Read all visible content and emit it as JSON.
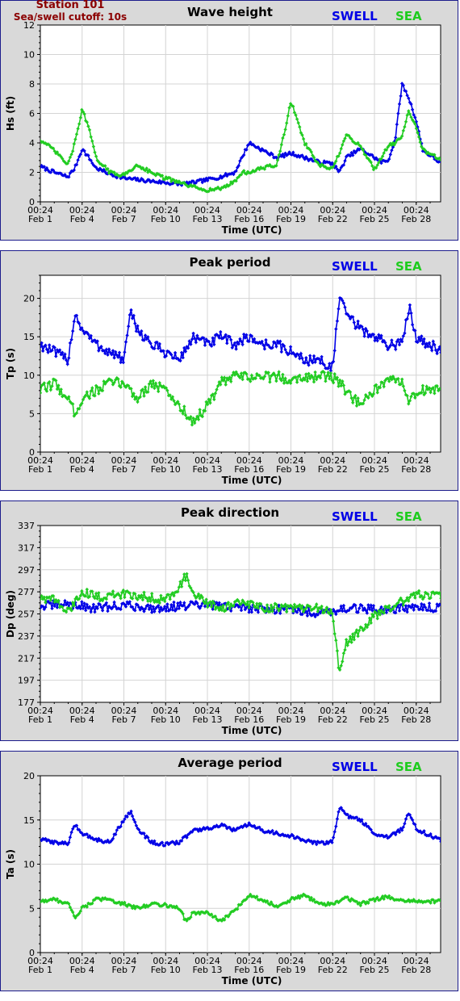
{
  "station": {
    "line1": "Station 101",
    "line2": "Sea/swell cutoff: 10s"
  },
  "legend": {
    "swell": "SWELL",
    "sea": "SEA"
  },
  "colors": {
    "swell": "#0000e6",
    "sea": "#22cc22",
    "panel": "#d9d9d9",
    "border": "#1c1c8c",
    "grid": "#d4d4d4"
  },
  "x_tick_labels": [
    [
      "00:24",
      "Feb 1"
    ],
    [
      "00:24",
      "Feb 4"
    ],
    [
      "00:24",
      "Feb 7"
    ],
    [
      "00:24",
      "Feb 10"
    ],
    [
      "00:24",
      "Feb 13"
    ],
    [
      "00:24",
      "Feb 16"
    ],
    [
      "00:24",
      "Feb 19"
    ],
    [
      "00:24",
      "Feb 22"
    ],
    [
      "00:24",
      "Feb 25"
    ],
    [
      "00:24",
      "Feb 28"
    ]
  ],
  "chart_data": [
    {
      "type": "scatter",
      "title": "Wave height",
      "ylabel": "Hs (ft)",
      "xlabel": "Time (UTC)",
      "ylim": [
        0,
        12
      ],
      "yticks": [
        "0",
        "2",
        "4",
        "6",
        "8",
        "10",
        "12"
      ],
      "xlim": [
        "Feb 1 00:24",
        "Mar 2 18:00"
      ],
      "grid": true,
      "legend_position": "top-right",
      "series": [
        {
          "name": "SWELL",
          "x": [
            "Feb 1 00:24",
            "Feb 2 00:00",
            "Feb 3 00:00",
            "Feb 3 12:00",
            "Feb 4 00:24",
            "Feb 4 12:00",
            "Feb 5 00:00",
            "Feb 6 00:00",
            "Feb 7 00:24",
            "Feb 8 00:00",
            "Feb 9 00:00",
            "Feb 10 00:24",
            "Feb 11 00:00",
            "Feb 12 00:00",
            "Feb 13 00:24",
            "Feb 14 00:00",
            "Feb 15 00:00",
            "Feb 15 12:00",
            "Feb 16 00:24",
            "Feb 17 00:00",
            "Feb 18 00:00",
            "Feb 19 00:24",
            "Feb 20 00:00",
            "Feb 21 00:00",
            "Feb 22 00:24",
            "Feb 22 12:00",
            "Feb 23 00:00",
            "Feb 24 00:00",
            "Feb 25 00:24",
            "Feb 25 12:00",
            "Feb 26 00:00",
            "Feb 26 12:00",
            "Feb 27 00:00",
            "Feb 27 12:00",
            "Feb 28 00:24",
            "Feb 28 12:00",
            "Mar 1 00:00",
            "Mar 1 12:00",
            "Mar 2 00:00",
            "Mar 2 18:00"
          ],
          "values": [
            2.4,
            2.0,
            1.7,
            2.3,
            3.6,
            3.0,
            2.3,
            1.9,
            1.6,
            1.5,
            1.4,
            1.3,
            1.2,
            1.3,
            1.5,
            1.7,
            2.0,
            3.0,
            4.0,
            3.5,
            3.0,
            3.3,
            3.0,
            2.7,
            2.6,
            2.0,
            3.0,
            3.6,
            3.0,
            2.7,
            2.8,
            4.2,
            8.0,
            7.0,
            5.5,
            3.5,
            2.5,
            2.0,
            2.1,
            2.3
          ]
        },
        {
          "name": "SEA",
          "x": [
            "Feb 1 00:24",
            "Feb 2 00:00",
            "Feb 3 00:00",
            "Feb 3 12:00",
            "Feb 4 00:24",
            "Feb 4 12:00",
            "Feb 5 00:00",
            "Feb 6 00:00",
            "Feb 7 00:24",
            "Feb 8 00:00",
            "Feb 9 00:00",
            "Feb 10 00:24",
            "Feb 11 00:00",
            "Feb 12 00:00",
            "Feb 13 00:24",
            "Feb 14 00:00",
            "Feb 15 00:00",
            "Feb 15 12:00",
            "Feb 16 00:24",
            "Feb 17 00:00",
            "Feb 18 00:00",
            "Feb 18 12:00",
            "Feb 19 00:24",
            "Feb 19 12:00",
            "Feb 20 00:00",
            "Feb 21 00:00",
            "Feb 22 00:24",
            "Feb 23 00:00",
            "Feb 24 00:00",
            "Feb 25 00:24",
            "Feb 26 00:00",
            "Feb 26 12:00",
            "Feb 27 00:00",
            "Feb 27 12:00",
            "Feb 28 00:24",
            "Feb 28 12:00",
            "Mar 1 00:00",
            "Mar 2 00:00",
            "Mar 2 18:00"
          ],
          "values": [
            4.2,
            3.5,
            2.5,
            4.0,
            6.3,
            5.0,
            3.0,
            2.0,
            1.8,
            2.5,
            2.0,
            1.6,
            1.3,
            1.0,
            0.8,
            0.9,
            1.4,
            2.0,
            2.0,
            2.3,
            2.5,
            4.5,
            6.8,
            5.5,
            4.0,
            2.5,
            2.2,
            4.5,
            3.8,
            2.2,
            3.8,
            4.0,
            4.5,
            6.2,
            5.0,
            3.5,
            2.8,
            2.5,
            2.5
          ]
        }
      ]
    },
    {
      "type": "scatter",
      "title": "Peak period",
      "ylabel": "Tp (s)",
      "xlabel": "Time (UTC)",
      "ylim": [
        0,
        23
      ],
      "yticks": [
        "0",
        "5",
        "10",
        "15",
        "20"
      ],
      "grid": true,
      "legend_position": "top-right",
      "series": [
        {
          "name": "SWELL",
          "x": [
            "Feb 1 00:24",
            "Feb 2 00:00",
            "Feb 3 00:00",
            "Feb 3 12:00",
            "Feb 4 00:24",
            "Feb 5 00:00",
            "Feb 6 00:00",
            "Feb 7 00:24",
            "Feb 7 12:00",
            "Feb 8 00:00",
            "Feb 9 00:00",
            "Feb 10 00:24",
            "Feb 11 00:00",
            "Feb 12 00:00",
            "Feb 13 00:24",
            "Feb 14 00:00",
            "Feb 15 00:00",
            "Feb 16 00:24",
            "Feb 17 00:00",
            "Feb 18 00:00",
            "Feb 19 00:24",
            "Feb 20 00:00",
            "Feb 21 00:00",
            "Feb 22 00:24",
            "Feb 22 12:00",
            "Feb 23 00:00",
            "Feb 24 00:00",
            "Feb 25 00:24",
            "Feb 26 00:00",
            "Feb 27 00:00",
            "Feb 27 12:00",
            "Feb 28 00:24",
            "Mar 1 00:00",
            "Mar 1 12:00",
            "Mar 2 00:00",
            "Mar 2 18:00"
          ],
          "values": [
            14,
            13,
            12,
            18,
            16,
            14,
            13,
            12,
            18,
            16,
            14,
            13,
            12,
            15,
            14,
            15,
            14,
            15,
            14,
            14,
            13,
            12,
            12,
            11,
            20,
            18,
            16,
            15,
            14,
            14,
            19,
            15,
            13,
            11,
            19,
            16
          ]
        },
        {
          "name": "SEA",
          "x": [
            "Feb 1 00:24",
            "Feb 2 00:00",
            "Feb 3 00:00",
            "Feb 3 12:00",
            "Feb 4 00:24",
            "Feb 5 00:00",
            "Feb 6 00:00",
            "Feb 7 00:24",
            "Feb 8 00:00",
            "Feb 9 00:00",
            "Feb 10 00:24",
            "Feb 11 00:00",
            "Feb 12 00:00",
            "Feb 13 00:24",
            "Feb 14 00:00",
            "Feb 15 00:00",
            "Feb 16 00:24",
            "Feb 17 00:00",
            "Feb 18 00:00",
            "Feb 19 00:24",
            "Feb 20 00:00",
            "Feb 21 00:00",
            "Feb 22 00:24",
            "Feb 23 00:00",
            "Feb 24 00:00",
            "Feb 25 00:24",
            "Feb 26 00:00",
            "Feb 27 00:00",
            "Feb 27 12:00",
            "Feb 28 00:24",
            "Mar 1 00:00",
            "Mar 2 00:00",
            "Mar 2 18:00"
          ],
          "values": [
            8,
            9,
            7,
            5,
            7,
            8,
            9,
            9,
            7,
            9,
            8,
            6,
            4,
            6,
            9,
            9.8,
            9.8,
            9.8,
            9.8,
            9.5,
            9.8,
            9.8,
            9.8,
            8,
            6,
            8,
            9,
            9.5,
            6,
            8,
            8,
            7.5,
            6.5
          ]
        }
      ]
    },
    {
      "type": "scatter",
      "title": "Peak direction",
      "ylabel": "Dp (deg)",
      "xlabel": "Time (UTC)",
      "ylim": [
        177,
        337
      ],
      "yticks": [
        "177",
        "197",
        "217",
        "237",
        "257",
        "277",
        "297",
        "317",
        "337"
      ],
      "grid": true,
      "legend_position": "top-right",
      "series": [
        {
          "name": "SWELL",
          "x": [
            "Feb 1 00:24",
            "Feb 3 00:00",
            "Feb 5 00:00",
            "Feb 7 00:24",
            "Feb 9 00:00",
            "Feb 11 00:00",
            "Feb 13 00:24",
            "Feb 15 00:00",
            "Feb 17 00:00",
            "Feb 19 00:24",
            "Feb 21 00:00",
            "Feb 23 00:00",
            "Feb 25 00:24",
            "Feb 27 00:00",
            "Mar 1 00:00",
            "Mar 2 18:00"
          ],
          "values": [
            264,
            266,
            262,
            265,
            262,
            264,
            265,
            263,
            262,
            261,
            258,
            262,
            261,
            262,
            263,
            262
          ]
        },
        {
          "name": "SEA",
          "x": [
            "Feb 1 00:24",
            "Feb 2 00:00",
            "Feb 3 00:00",
            "Feb 4 00:24",
            "Feb 5 00:00",
            "Feb 7 00:24",
            "Feb 9 00:00",
            "Feb 10 00:24",
            "Feb 11 00:00",
            "Feb 11 12:00",
            "Feb 12 00:00",
            "Feb 13 00:24",
            "Feb 14 00:00",
            "Feb 15 00:00",
            "Feb 17 00:00",
            "Feb 19 00:24",
            "Feb 20 00:00",
            "Feb 21 00:00",
            "Feb 22 00:24",
            "Feb 22 12:00",
            "Feb 23 00:00",
            "Feb 24 00:00",
            "Feb 25 00:24",
            "Feb 26 00:00",
            "Feb 27 00:00",
            "Feb 28 00:24",
            "Mar 1 00:00",
            "Mar 2 18:00"
          ],
          "values": [
            272,
            270,
            258,
            278,
            272,
            275,
            272,
            270,
            282,
            292,
            275,
            266,
            262,
            267,
            263,
            262,
            262,
            262,
            258,
            204,
            230,
            242,
            255,
            262,
            268,
            274,
            274,
            270
          ]
        }
      ]
    },
    {
      "type": "scatter",
      "title": "Average period",
      "ylabel": "Ta (s)",
      "xlabel": "Time (UTC)",
      "ylim": [
        0,
        20
      ],
      "yticks": [
        "0",
        "5",
        "10",
        "15",
        "20"
      ],
      "grid": true,
      "legend_position": "top-right",
      "series": [
        {
          "name": "SWELL",
          "x": [
            "Feb 1 00:24",
            "Feb 2 00:00",
            "Feb 3 00:00",
            "Feb 3 12:00",
            "Feb 4 00:24",
            "Feb 5 00:00",
            "Feb 6 00:00",
            "Feb 7 00:24",
            "Feb 7 12:00",
            "Feb 8 00:00",
            "Feb 9 00:00",
            "Feb 10 00:24",
            "Feb 11 00:00",
            "Feb 12 00:00",
            "Feb 13 00:24",
            "Feb 14 00:00",
            "Feb 15 00:00",
            "Feb 16 00:24",
            "Feb 17 00:00",
            "Feb 18 00:00",
            "Feb 19 00:24",
            "Feb 20 00:00",
            "Feb 21 00:00",
            "Feb 22 00:24",
            "Feb 22 12:00",
            "Feb 23 00:00",
            "Feb 24 00:00",
            "Feb 25 00:24",
            "Feb 26 00:00",
            "Feb 27 00:00",
            "Feb 27 12:00",
            "Feb 28 00:24",
            "Mar 1 00:00",
            "Mar 1 12:00",
            "Mar 2 00:00",
            "Mar 2 18:00"
          ],
          "values": [
            12.8,
            12.5,
            12.3,
            14.5,
            13.5,
            12.8,
            12.5,
            15.0,
            16.0,
            14.0,
            12.5,
            12.2,
            12.5,
            13.8,
            14.0,
            14.4,
            13.8,
            14.5,
            13.8,
            13.5,
            13.2,
            12.6,
            12.4,
            12.5,
            16.5,
            15.5,
            15.0,
            13.5,
            13.0,
            14.0,
            15.8,
            14.0,
            12.5,
            13.0,
            16.0,
            15.8
          ]
        },
        {
          "name": "SEA",
          "x": [
            "Feb 1 00:24",
            "Feb 2 00:00",
            "Feb 3 00:00",
            "Feb 3 12:00",
            "Feb 4 00:24",
            "Feb 5 00:00",
            "Feb 6 00:00",
            "Feb 7 00:24",
            "Feb 8 00:00",
            "Feb 9 00:00",
            "Feb 10 00:24",
            "Feb 11 00:00",
            "Feb 11 12:00",
            "Feb 12 00:00",
            "Feb 13 00:24",
            "Feb 14 00:00",
            "Feb 15 00:00",
            "Feb 16 00:24",
            "Feb 17 00:00",
            "Feb 18 00:00",
            "Feb 19 00:24",
            "Feb 20 00:00",
            "Feb 21 00:00",
            "Feb 22 00:24",
            "Feb 23 00:00",
            "Feb 24 00:00",
            "Feb 25 00:24",
            "Feb 26 00:00",
            "Feb 27 00:00",
            "Feb 28 00:24",
            "Mar 1 00:00",
            "Mar 2 00:00",
            "Mar 2 18:00"
          ],
          "values": [
            5.8,
            6.0,
            5.6,
            4.0,
            5.0,
            6.0,
            6.0,
            5.5,
            5.0,
            5.5,
            5.4,
            5.0,
            3.5,
            4.5,
            4.5,
            3.5,
            4.8,
            6.5,
            6.0,
            5.2,
            6.0,
            6.5,
            5.5,
            5.5,
            6.2,
            5.5,
            6.0,
            6.3,
            5.8,
            5.8,
            5.8,
            5.5,
            4.8
          ]
        }
      ]
    }
  ]
}
